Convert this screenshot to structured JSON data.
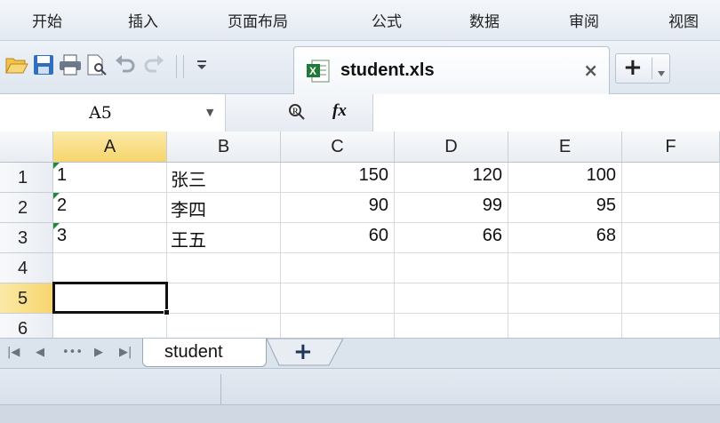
{
  "menu": {
    "items": [
      "开始",
      "插入",
      "页面布局",
      "公式",
      "数据",
      "审阅",
      "视图"
    ]
  },
  "toolbar": {
    "icons": [
      "open-folder-icon",
      "save-icon",
      "print-icon",
      "print-preview-icon",
      "undo-icon",
      "redo-icon",
      "customize-dropdown-icon"
    ]
  },
  "tab": {
    "title": "student.xls",
    "close": "×",
    "new_tab": "+"
  },
  "formula_bar": {
    "name_box": "A5",
    "fx": "fx",
    "formula": ""
  },
  "grid": {
    "columns": [
      "A",
      "B",
      "C",
      "D",
      "E",
      "F"
    ],
    "rows": [
      "1",
      "2",
      "3",
      "4",
      "5",
      "6"
    ],
    "selected_cell": "A5",
    "cells": [
      [
        "1",
        "张三",
        "150",
        "120",
        "100",
        ""
      ],
      [
        "2",
        "李四",
        "90",
        "99",
        "95",
        ""
      ],
      [
        "3",
        "王五",
        "60",
        "66",
        "68",
        ""
      ],
      [
        "",
        "",
        "",
        "",
        "",
        ""
      ],
      [
        "",
        "",
        "",
        "",
        "",
        ""
      ],
      [
        "",
        "",
        "",
        "",
        "",
        ""
      ]
    ]
  },
  "sheets": {
    "tabs": [
      "student"
    ],
    "add_label": "+"
  },
  "colors": {
    "selection_header": "#f7d56d",
    "text_number_marker": "#1f8a3b",
    "accent_blue": "#2f6fbd"
  }
}
